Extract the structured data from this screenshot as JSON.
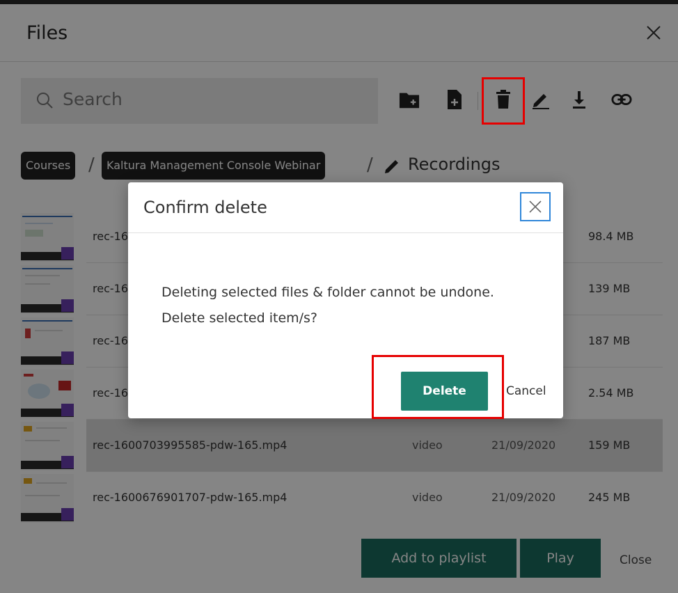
{
  "header": {
    "title": "Files"
  },
  "search": {
    "placeholder": "Search"
  },
  "toolbar": {
    "icons": [
      "new-folder-icon",
      "new-file-icon",
      "trash-icon",
      "edit-icon",
      "download-icon",
      "link-icon"
    ]
  },
  "breadcrumb": {
    "items": [
      "Courses",
      "Kaltura Management Console Webinar"
    ],
    "separator": "/",
    "current": "Recordings"
  },
  "files": [
    {
      "name": "rec-16",
      "size": "98.4 MB"
    },
    {
      "name": "rec-16",
      "size": "139 MB"
    },
    {
      "name": "rec-16",
      "size": "187 MB"
    },
    {
      "name": "rec-16",
      "size": "2.54 MB"
    },
    {
      "name": "rec-1600703995585-pdw-165.mp4",
      "type": "video",
      "date": "21/09/2020",
      "size": "159 MB"
    },
    {
      "name": "rec-1600676901707-pdw-165.mp4",
      "type": "video",
      "date": "21/09/2020",
      "size": "245 MB"
    }
  ],
  "footer": {
    "add_to_playlist": "Add to playlist",
    "play": "Play",
    "close": "Close"
  },
  "modal": {
    "title": "Confirm delete",
    "message_line1": "Deleting selected files & folder cannot be undone.",
    "message_line2": "Delete selected item/s?",
    "delete_label": "Delete",
    "cancel_label": "Cancel"
  },
  "colors": {
    "primary": "#1a6b5e",
    "delete_button": "#1f8270",
    "highlight": "#e60000",
    "focus": "#2f86d9"
  }
}
